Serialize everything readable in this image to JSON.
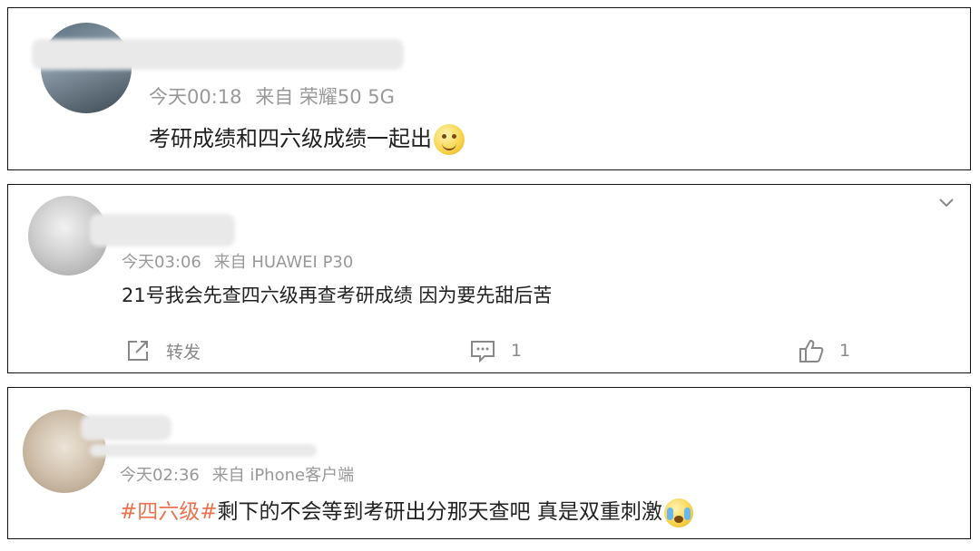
{
  "posts": [
    {
      "time": "今天00:18",
      "source": "来自 荣耀50 5G",
      "text": "考研成绩和四六级成绩一起出",
      "emoji": "smile-emoji"
    },
    {
      "time": "今天03:06",
      "source": "来自 HUAWEI P30",
      "text": "21号我会先查四六级再查考研成绩 因为要先甜后苦",
      "actions": {
        "share_label": "转发",
        "comment_count": "1",
        "like_count": "1"
      }
    },
    {
      "time": "今天02:36",
      "source": "来自 iPhone客户端",
      "hashtag": "#四六级#",
      "text": "剩下的不会等到考研出分那天查吧 真是双重刺激",
      "emoji": "crying-emoji"
    }
  ],
  "colors": {
    "hashtag": "#eb7350",
    "meta": "#999999",
    "icon": "#888888"
  }
}
